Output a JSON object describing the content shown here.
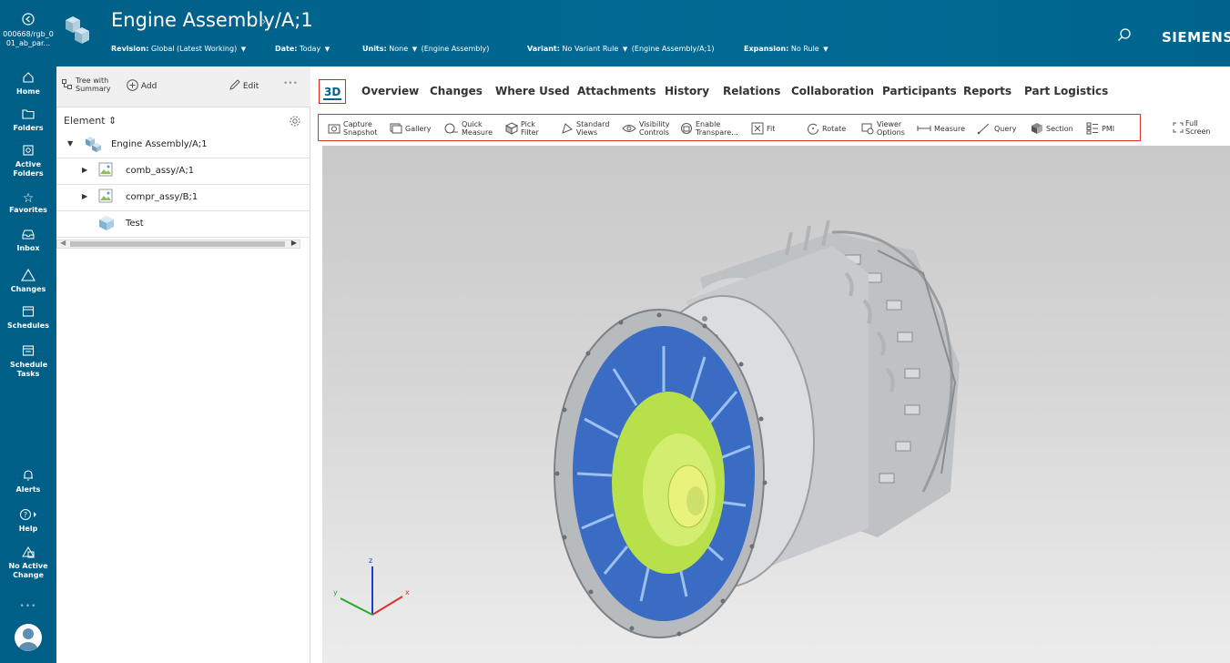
{
  "header": {
    "back_label": "000668/rgb_001_ab_par...",
    "title": "Engine Assembly/A;1",
    "context": {
      "revision_label": "Revision:",
      "revision_value": "Global (Latest Working)",
      "date_label": "Date:",
      "date_value": "Today",
      "units_label": "Units:",
      "units_value": "None",
      "units_note": "(Engine Assembly)",
      "variant_label": "Variant:",
      "variant_value": "No Variant Rule",
      "variant_note": "(Engine Assembly/A;1)",
      "expansion_label": "Expansion:",
      "expansion_value": "No Rule"
    },
    "brand": "SIEMENS"
  },
  "nav": {
    "items": [
      {
        "label": "Home",
        "icon": "home-icon"
      },
      {
        "label": "Folders",
        "icon": "folder-icon"
      },
      {
        "label": "Active Folders",
        "icon": "active-folder-icon"
      },
      {
        "label": "Favorites",
        "icon": "star-icon"
      },
      {
        "label": "Inbox",
        "icon": "inbox-icon"
      },
      {
        "label": "Changes",
        "icon": "changes-icon"
      },
      {
        "label": "Schedules",
        "icon": "schedule-icon"
      },
      {
        "label": "Schedule Tasks",
        "icon": "schedule-tasks-icon"
      }
    ],
    "bottom": [
      {
        "label": "Alerts",
        "icon": "bell-icon"
      },
      {
        "label": "Help",
        "icon": "help-icon"
      },
      {
        "label": "No Active Change",
        "icon": "change-icon"
      }
    ],
    "more": "•••"
  },
  "tree": {
    "toolbar": {
      "tree_label_1": "Tree with",
      "tree_label_2": "Summary",
      "add_label": "Add",
      "edit_label": "Edit",
      "more": "•••"
    },
    "column_header": "Element",
    "rows": [
      {
        "label": "Engine Assembly/A;1"
      },
      {
        "label": "comb_assy/A;1"
      },
      {
        "label": "compr_assy/B;1"
      },
      {
        "label": "Test"
      }
    ]
  },
  "tabs": [
    "3D",
    "Overview",
    "Changes",
    "Where Used",
    "Attachments",
    "History",
    "Relations",
    "Collaboration",
    "Participants",
    "Reports",
    "Part Logistics"
  ],
  "viewer_toolbar": {
    "capture_1": "Capture",
    "capture_2": "Snapshot",
    "gallery": "Gallery",
    "quick_1": "Quick",
    "quick_2": "Measure",
    "pick_1": "Pick",
    "pick_2": "Filter",
    "standard_1": "Standard",
    "standard_2": "Views",
    "visibility_1": "Visibility",
    "visibility_2": "Controls",
    "enable_1": "Enable",
    "enable_2": "Transpare...",
    "fit": "Fit",
    "rotate": "Rotate",
    "viewer_1": "Viewer",
    "viewer_2": "Options",
    "measure": "Measure",
    "query": "Query",
    "section": "Section",
    "pmi": "PMI",
    "full_1": "Full",
    "full_2": "Screen"
  },
  "axes": {
    "x": "x",
    "y": "y",
    "z": "z"
  },
  "colors": {
    "header_bg": "#005f87",
    "accent": "#00638f",
    "highlight": "#dd2222"
  }
}
